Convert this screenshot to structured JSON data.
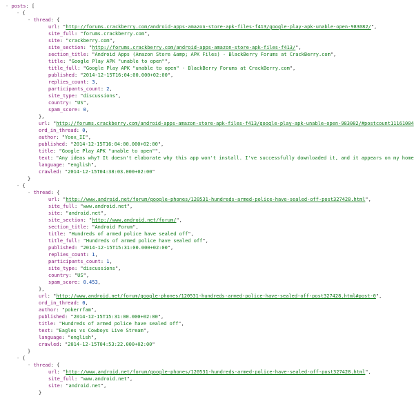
{
  "root_key": "posts",
  "posts": [
    {
      "thread": {
        "url": "http://forums.crackberry.com/android-apps-amazon-store-apk-files-f413/google-play-apk-unable-open-983082/",
        "site_full": "forums.crackberry.com",
        "site": "crackberry.com",
        "site_section": "http://forums.crackberry.com/android-apps-amazon-store-apk-files-f413/",
        "section_title": "Android Apps (Amazon Store &amp; APK Files) - BlackBerry Forums at CrackBerry.com",
        "title": "Google Play APK \"unable to open\"",
        "title_full": "Google Play APK \"unable to open\" - BlackBerry Forums at CrackBerry.com",
        "published": "2014-12-15T16:04:00.000+02:00",
        "replies_count": 3,
        "participants_count": 2,
        "site_type": "discussions",
        "country": "US",
        "spam_score": 0
      },
      "url": "http://forums.crackberry.com/android-apps-amazon-store-apk-files-f413/google-play-apk-unable-open-983082/#postcount11161084",
      "ord_in_thread": 0,
      "author": "Yoox_II",
      "published": "2014-12-15T16:04:00.000+02:00",
      "title": "Google Play APK \"unable to open\"",
      "text": "Any ideas why? It doesn't elaborate why this app won't install. I've successfully downloaded it, and it appears on my home pag",
      "language": "english",
      "crawled": "2014-12-15T04:38:03.000+02:00"
    },
    {
      "thread": {
        "url": "http://www.android.net/forum/google-phones/120531-hundreds-armed-police-have-sealed-off-post327428.html",
        "site_full": "www.android.net",
        "site": "android.net",
        "site_section": "http://www.android.net/forum/",
        "section_title": "Android Forum",
        "title": "Hundreds of armed police have sealed off",
        "title_full": "Hundreds of armed police have sealed off",
        "published": "2014-12-15T15:31:00.000+02:00",
        "replies_count": 1,
        "participants_count": 1,
        "site_type": "discussions",
        "country": "US",
        "spam_score": 0.453
      },
      "url": "http://www.android.net/forum/google-phones/120531-hundreds-armed-police-have-sealed-off-post327428.html#post-0",
      "ord_in_thread": 0,
      "author": "pokerrfam",
      "published": "2014-12-15T15:31:00.000+02:00",
      "title": "Hundreds of armed police have sealed off",
      "text": "Eagles vs Cowboys Live Stream",
      "language": "english",
      "crawled": "2014-12-15T04:53:22.000+02:00"
    },
    {
      "thread": {
        "url": "http://www.android.net/forum/google-phones/120531-hundreds-armed-police-have-sealed-off-post327428.html",
        "site_full": "www.android.net",
        "site": "android.net"
      }
    }
  ]
}
